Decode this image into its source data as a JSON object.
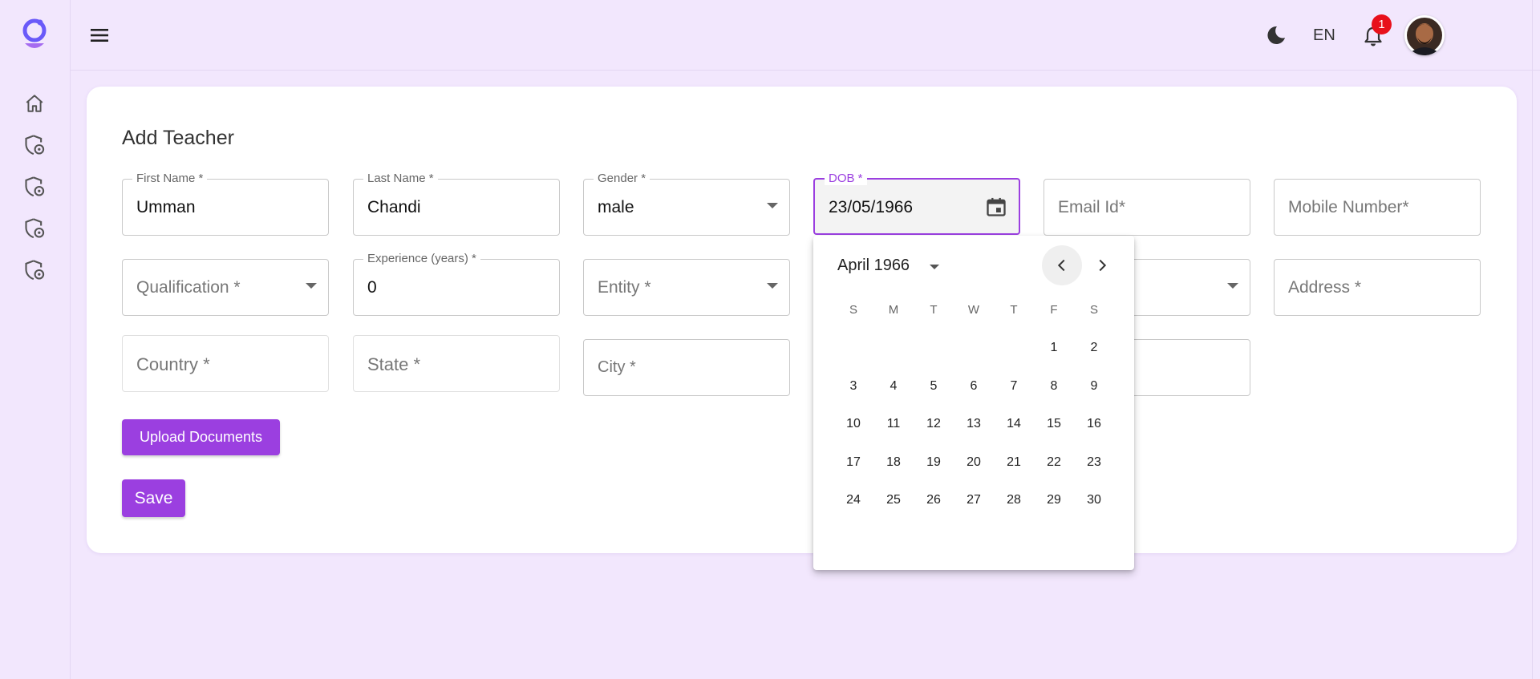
{
  "header": {
    "language": "EN",
    "notification_count": "1"
  },
  "page": {
    "title": "Add Teacher"
  },
  "form": {
    "first_name": {
      "label": "First Name *",
      "value": "Umman"
    },
    "last_name": {
      "label": "Last Name *",
      "value": "Chandi"
    },
    "gender": {
      "label": "Gender *",
      "value": "male"
    },
    "dob": {
      "label": "DOB *",
      "value": "23/05/1966"
    },
    "email": {
      "placeholder": "Email Id*"
    },
    "mobile": {
      "placeholder": "Mobile Number*"
    },
    "qualification": {
      "placeholder": "Qualification *"
    },
    "experience": {
      "label": "Experience (years) *",
      "value": "0"
    },
    "entity": {
      "placeholder": "Entity *"
    },
    "address": {
      "placeholder": "Address *"
    },
    "country": {
      "placeholder": "Country *"
    },
    "state": {
      "placeholder": "State *"
    },
    "city": {
      "placeholder": "City *"
    }
  },
  "buttons": {
    "upload": "Upload Documents",
    "save": "Save"
  },
  "datepicker": {
    "month_label": "April 1966",
    "weekdays": [
      "S",
      "M",
      "T",
      "W",
      "T",
      "F",
      "S"
    ],
    "first_weekday_index": 5,
    "days": [
      "1",
      "2",
      "3",
      "4",
      "5",
      "6",
      "7",
      "8",
      "9",
      "10",
      "11",
      "12",
      "13",
      "14",
      "15",
      "16",
      "17",
      "18",
      "19",
      "20",
      "21",
      "22",
      "23",
      "24",
      "25",
      "26",
      "27",
      "28",
      "29",
      "30"
    ]
  },
  "colors": {
    "accent": "#9b3fe0",
    "background": "#f2e7fd",
    "badge": "#e8101b"
  }
}
